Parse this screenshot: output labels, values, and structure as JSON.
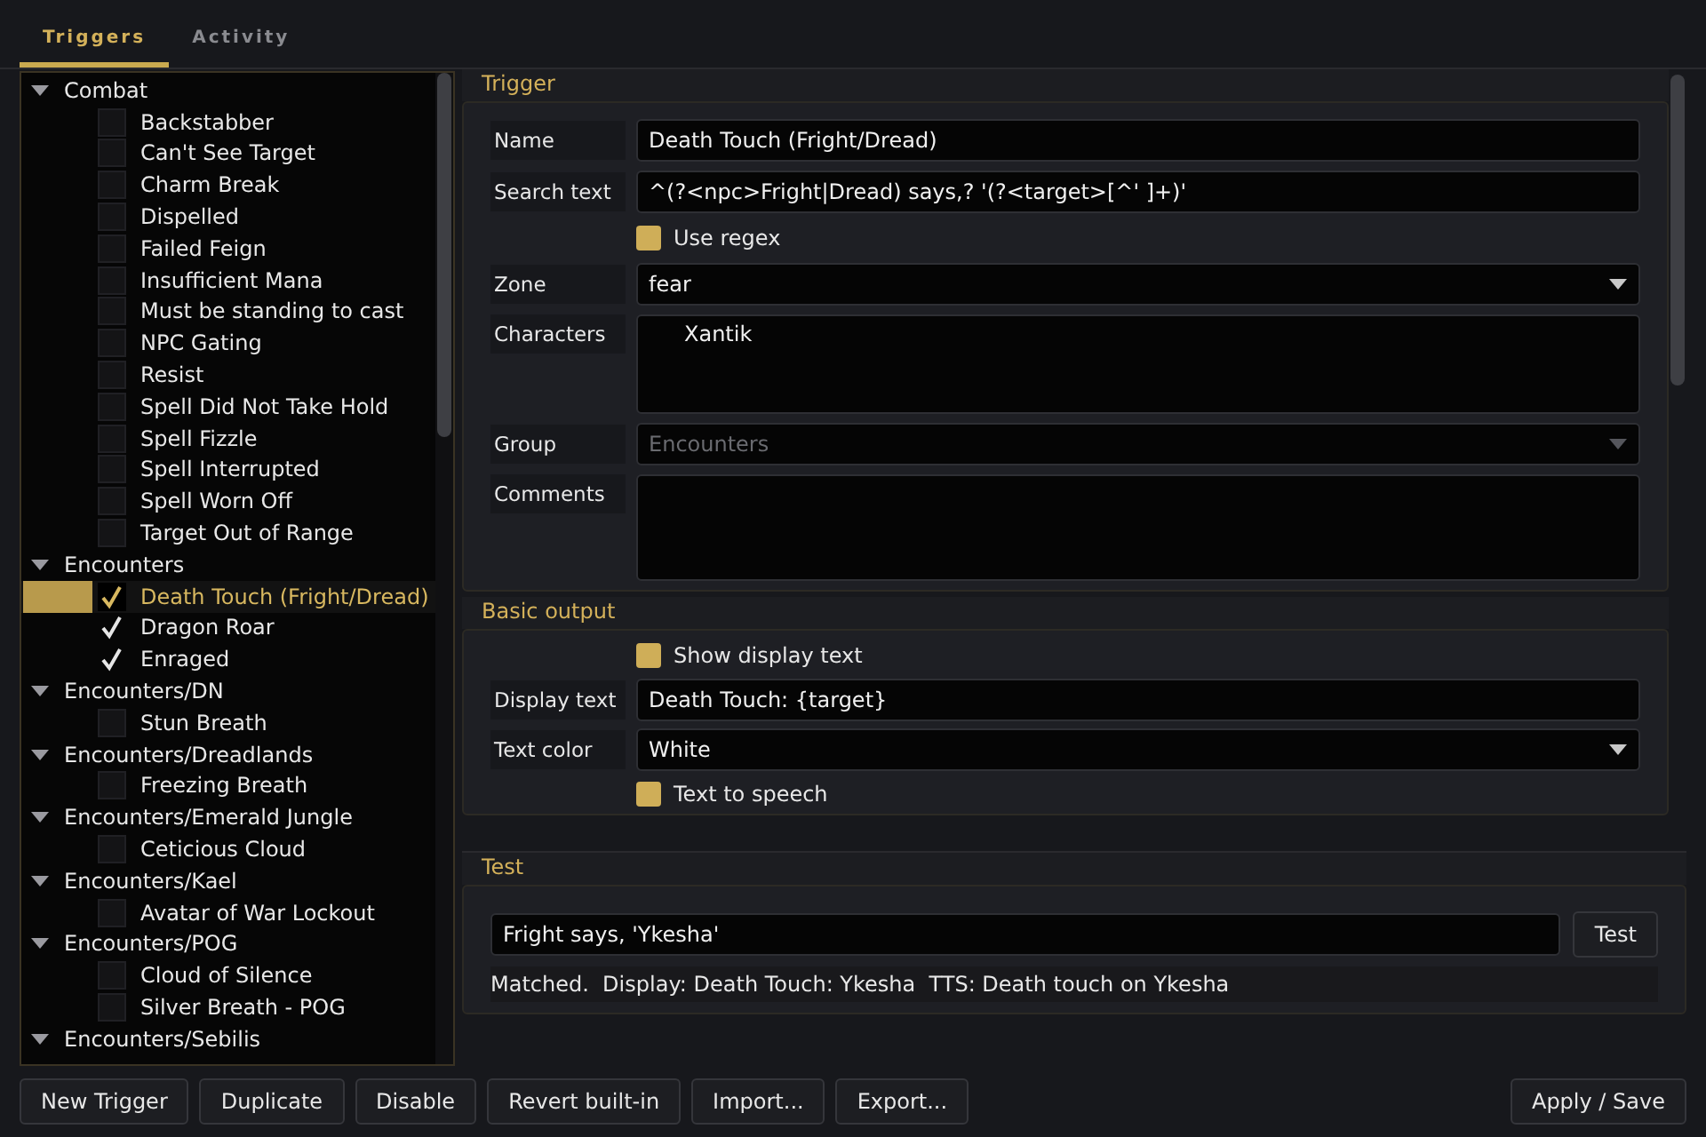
{
  "tabs": [
    {
      "label": "Triggers",
      "selected": true
    },
    {
      "label": "Activity",
      "selected": false
    }
  ],
  "tree": [
    {
      "label": "Combat",
      "expanded": true,
      "children": [
        {
          "label": "Backstabber",
          "checked": false,
          "selected": false
        },
        {
          "label": "Can't See Target",
          "checked": false,
          "selected": false
        },
        {
          "label": "Charm Break",
          "checked": false,
          "selected": false
        },
        {
          "label": "Dispelled",
          "checked": false,
          "selected": false
        },
        {
          "label": "Failed Feign",
          "checked": false,
          "selected": false
        },
        {
          "label": "Insufficient Mana",
          "checked": false,
          "selected": false
        },
        {
          "label": "Must be standing to cast",
          "checked": false,
          "selected": false
        },
        {
          "label": "NPC Gating",
          "checked": false,
          "selected": false
        },
        {
          "label": "Resist",
          "checked": false,
          "selected": false
        },
        {
          "label": "Spell Did Not Take Hold",
          "checked": false,
          "selected": false
        },
        {
          "label": "Spell Fizzle",
          "checked": false,
          "selected": false
        },
        {
          "label": "Spell Interrupted",
          "checked": false,
          "selected": false
        },
        {
          "label": "Spell Worn Off",
          "checked": false,
          "selected": false
        },
        {
          "label": "Target Out of Range",
          "checked": false,
          "selected": false
        }
      ]
    },
    {
      "label": "Encounters",
      "expanded": true,
      "children": [
        {
          "label": "Death Touch (Fright/Dread)",
          "checked": true,
          "selected": true
        },
        {
          "label": "Dragon Roar",
          "checked": true,
          "selected": false
        },
        {
          "label": "Enraged",
          "checked": true,
          "selected": false
        }
      ]
    },
    {
      "label": "Encounters/DN",
      "expanded": true,
      "children": [
        {
          "label": "Stun Breath",
          "checked": false,
          "selected": false
        }
      ]
    },
    {
      "label": "Encounters/Dreadlands",
      "expanded": true,
      "children": [
        {
          "label": "Freezing Breath",
          "checked": false,
          "selected": false
        }
      ]
    },
    {
      "label": "Encounters/Emerald Jungle",
      "expanded": true,
      "children": [
        {
          "label": "Ceticious Cloud",
          "checked": false,
          "selected": false
        }
      ]
    },
    {
      "label": "Encounters/Kael",
      "expanded": true,
      "children": [
        {
          "label": "Avatar of War Lockout",
          "checked": false,
          "selected": false
        }
      ]
    },
    {
      "label": "Encounters/POG",
      "expanded": true,
      "children": [
        {
          "label": "Cloud of Silence",
          "checked": false,
          "selected": false
        },
        {
          "label": "Silver Breath - POG",
          "checked": false,
          "selected": false
        }
      ]
    },
    {
      "label": "Encounters/Sebilis",
      "expanded": true
    }
  ],
  "trigger": {
    "title": "Trigger",
    "name": {
      "label": "Name",
      "value": "Death Touch (Fright/Dread)"
    },
    "search_text": {
      "label": "Search text",
      "value": "^(?<npc>Fright|Dread) says,? '(?<target>[^' ]+)'"
    },
    "use_regex": {
      "label": "Use regex",
      "checked": true
    },
    "zone": {
      "label": "Zone",
      "value": "fear"
    },
    "characters": {
      "label": "Characters",
      "items": [
        "Xantik"
      ]
    },
    "group": {
      "label": "Group",
      "value": "Encounters",
      "disabled": true
    },
    "comments": {
      "label": "Comments"
    }
  },
  "basic_output": {
    "title": "Basic output",
    "show_display_text": {
      "label": "Show display text",
      "checked": true
    },
    "display_text": {
      "label": "Display text",
      "value": "Death Touch: {target}"
    },
    "text_color": {
      "label": "Text color",
      "value": "White"
    },
    "text_to_speech": {
      "label": "Text to speech",
      "checked": true
    }
  },
  "test": {
    "title": "Test",
    "input": "Fright says, 'Ykesha'",
    "button": "Test",
    "result": "Matched.  Display: Death Touch: Ykesha  TTS: Death touch on Ykesha"
  },
  "buttons": [
    "New Trigger",
    "Duplicate",
    "Disable",
    "Revert built-in",
    "Import...",
    "Export..."
  ],
  "apply_button": "Apply / Save"
}
